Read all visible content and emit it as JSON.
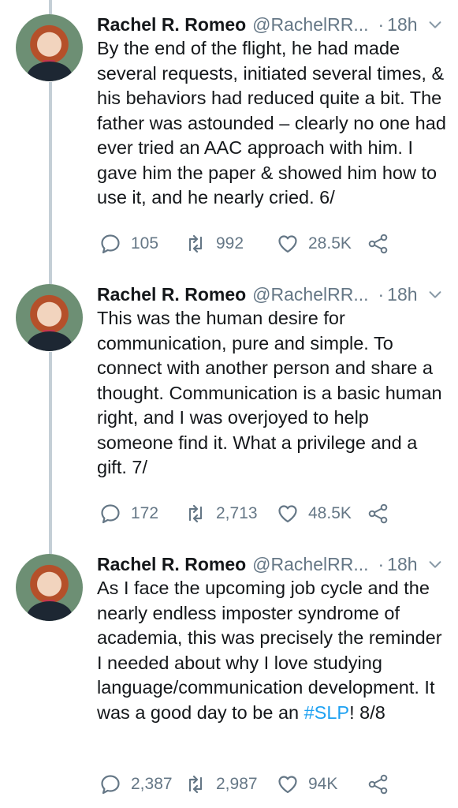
{
  "tweets": [
    {
      "name": "Rachel R. Romeo",
      "handle": "@RachelRR...",
      "dot": "·",
      "time": "18h",
      "text": "By the end of the flight, he had made several requests, initiated several times, & his behaviors had reduced quite a bit. The father was astounded – clearly no one had ever tried an AAC approach with him. I gave him the paper & showed him how to use it, and he nearly cried. 6/",
      "replies": "105",
      "retweets": "992",
      "likes": "28.5K"
    },
    {
      "name": "Rachel R. Romeo",
      "handle": "@RachelRR...",
      "dot": "·",
      "time": "18h",
      "text": "This was the human desire for communication, pure and simple. To connect with another person and share a thought. Communication is a basic human right, and I was overjoyed to help someone find it. What a privilege and a gift. 7/",
      "replies": "172",
      "retweets": "2,713",
      "likes": "48.5K"
    },
    {
      "name": "Rachel R. Romeo",
      "handle": "@RachelRR...",
      "dot": "·",
      "time": "18h",
      "text_before": "As I face the upcoming job cycle and the nearly endless imposter syndrome of academia, this was precisely the reminder I needed about why I love studying language/communication development. It was a good day to be an ",
      "hashtag": "#SLP",
      "text_after": "! 8/8",
      "replies": "2,387",
      "retweets": "2,987",
      "likes": "94K"
    }
  ],
  "icons": {
    "reply": "speech-bubble",
    "retweet": "retweet-arrows",
    "like": "heart-outline",
    "share": "share-nodes",
    "menu": "chevron-down"
  },
  "colors": {
    "text": "#14171a",
    "secondary": "#657786",
    "link": "#1da1f2",
    "thread_line": "#c4cfd6"
  }
}
